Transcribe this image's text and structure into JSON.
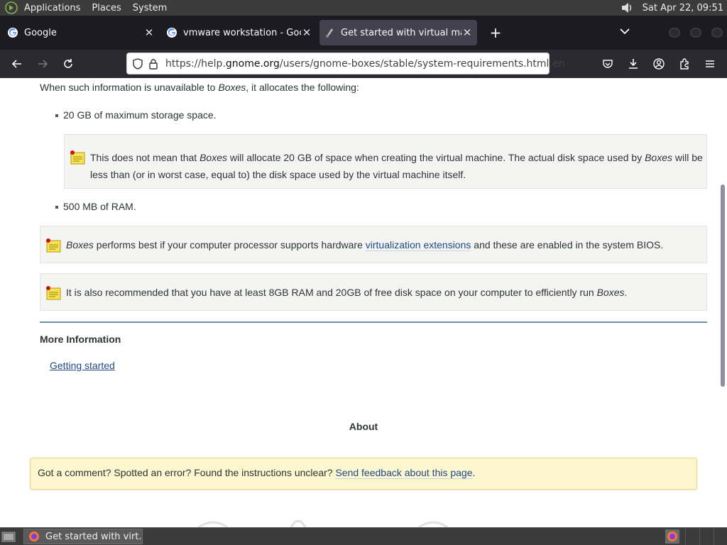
{
  "top_panel": {
    "menus": [
      "Applications",
      "Places",
      "System"
    ],
    "clock": "Sat Apr 22, 09:51"
  },
  "tabs": [
    {
      "title": "Google",
      "favicon": "google-icon",
      "active": false
    },
    {
      "title": "vmware workstation - Google",
      "favicon": "google-icon",
      "active": false
    },
    {
      "title": "Get started with virtual machine",
      "favicon": "gnome-help-icon",
      "active": true
    }
  ],
  "navbar": {
    "url_prefix": "https://help.",
    "url_domain": "gnome.org",
    "url_path": "/users/gnome-boxes/stable/system-requirements.html.en"
  },
  "content": {
    "intro_a": "When such information is unavailable to ",
    "intro_em": "Boxes",
    "intro_b": ", it allocates the following:",
    "bullet1": "20 GB of maximum storage space.",
    "note1_a": "This does not mean that ",
    "note1_em1": "Boxes",
    "note1_b": " will allocate 20 GB of space when creating the virtual machine. The actual disk space used by ",
    "note1_em2": "Boxes",
    "note1_c": " will be less than (or in worst case, equal to) the disk space used by the virtual machine itself.",
    "bullet2": "500 MB of RAM.",
    "note2_em": "Boxes",
    "note2_a": " performs best if your computer processor supports hardware ",
    "note2_link": "virtualization extensions",
    "note2_b": " and these are enabled in the system BIOS.",
    "note3_a": "It is also recommended that you have at least 8GB RAM and 20GB of free disk space on your computer to efficiently run ",
    "note3_em": "Boxes",
    "note3_b": ".",
    "more_heading": "More Information",
    "more_link": "Getting started",
    "about": "About",
    "feedback_a": "Got a comment? Spotted an error? Found the instructions unclear? ",
    "feedback_link": "Send feedback about this page",
    "feedback_b": "."
  },
  "taskbar": {
    "task_title": "Get started with virt..."
  },
  "colors": {
    "link": "#204a87",
    "note_bg": "#f4f4f2",
    "feedback_bg": "#fcf7cf",
    "divider": "#6a93a9"
  }
}
